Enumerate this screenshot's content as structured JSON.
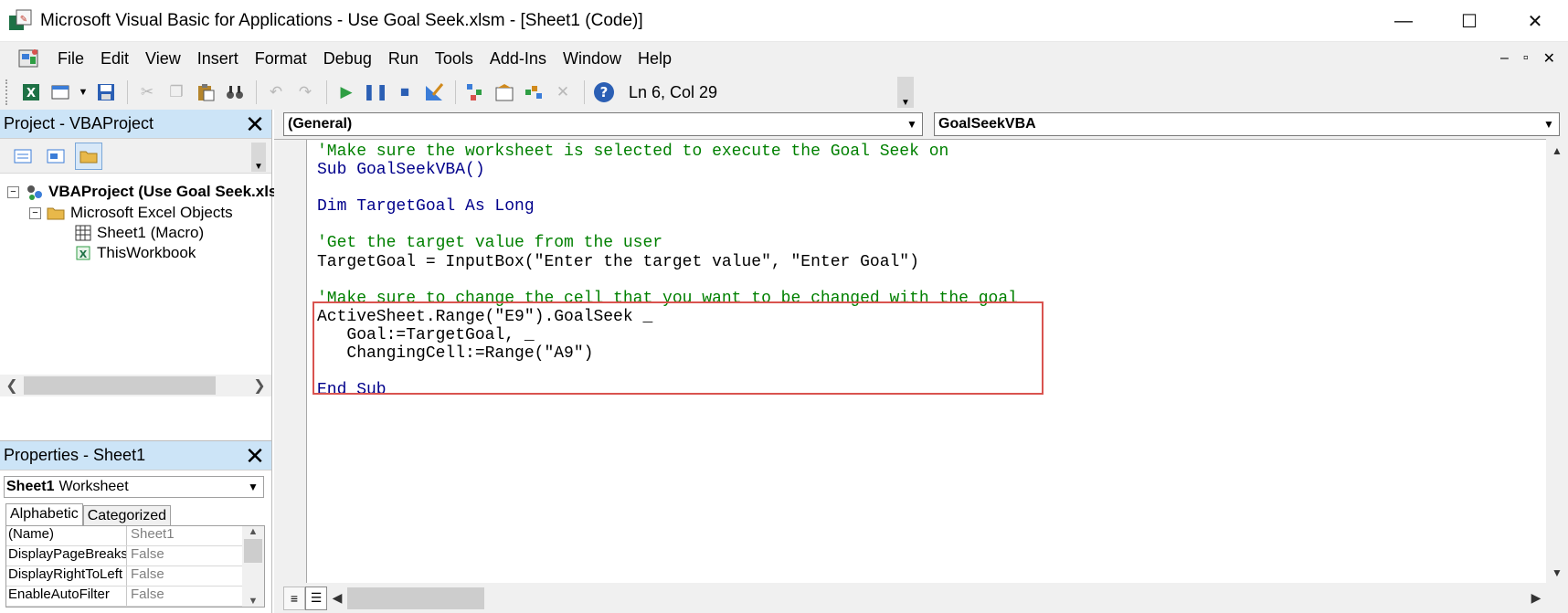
{
  "window": {
    "title": "Microsoft Visual Basic for Applications - Use Goal Seek.xlsm - [Sheet1 (Code)]",
    "minimize": "—",
    "maximize": "☐",
    "close": "✕"
  },
  "menu": {
    "items": [
      "File",
      "Edit",
      "View",
      "Insert",
      "Format",
      "Debug",
      "Run",
      "Tools",
      "Add-Ins",
      "Window",
      "Help"
    ],
    "mdi_minimize": "–",
    "mdi_restore": "▫",
    "mdi_close": "✕"
  },
  "toolbar": {
    "cursor_position": "Ln 6, Col 29"
  },
  "project_pane": {
    "title": "Project - VBAProject",
    "tree": {
      "root": "VBAProject (Use Goal Seek.xlsm)",
      "folder": "Microsoft Excel Objects",
      "items": [
        "Sheet1 (Macro)",
        "ThisWorkbook"
      ]
    }
  },
  "properties_pane": {
    "title": "Properties - Sheet1",
    "object_name": "Sheet1",
    "object_type": "Worksheet",
    "tabs": [
      "Alphabetic",
      "Categorized"
    ],
    "rows": [
      {
        "name": "(Name)",
        "value": "Sheet1"
      },
      {
        "name": "DisplayPageBreaks",
        "value": "False"
      },
      {
        "name": "DisplayRightToLeft",
        "value": "False"
      },
      {
        "name": "EnableAutoFilter",
        "value": "False"
      }
    ]
  },
  "code_window": {
    "object_combo": "(General)",
    "procedure_combo": "GoalSeekVBA",
    "lines": [
      "'Make sure the worksheet is selected to execute the Goal Seek on",
      "Sub GoalSeekVBA()",
      "",
      "Dim TargetGoal As Long",
      "",
      "'Get the target value from the user",
      "TargetGoal = InputBox(\"Enter the target value\", \"Enter Goal\")",
      "",
      "'Make sure to change the cell that you want to be changed with the goal",
      "ActiveSheet.Range(\"E9\").GoalSeek _",
      "   Goal:=TargetGoal, _",
      "   ChangingCell:=Range(\"A9\")",
      "",
      "End Sub"
    ]
  },
  "colors": {
    "comment": "#008000",
    "keyword": "#00008b",
    "highlight_border": "#d9534f",
    "pane_title_bg": "#cce4f7"
  }
}
